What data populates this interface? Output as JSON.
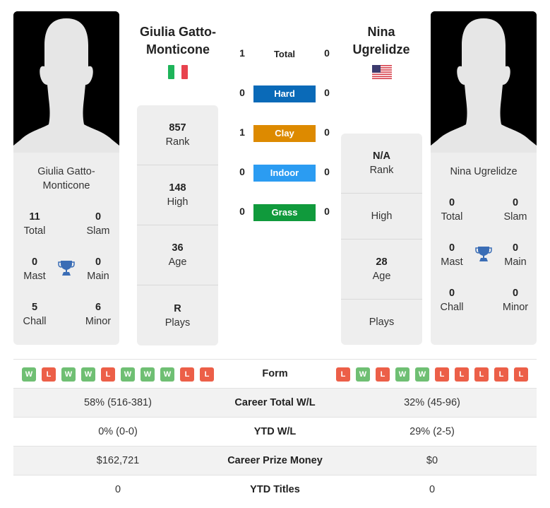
{
  "colors": {
    "hard": "#0a6ab8",
    "clay": "#dd8a00",
    "indoor": "#2b9cf2",
    "grass": "#109a3c",
    "win": "#6fbf73",
    "loss": "#ec5f48",
    "trophy": "#3a6db5"
  },
  "player1": {
    "name": "Giulia Gatto-Monticone",
    "card_name": "Giulia Gatto-Monticone",
    "flag": "italy-flag",
    "stats": {
      "rank": {
        "value": "857",
        "label": "Rank"
      },
      "high": {
        "value": "148",
        "label": "High"
      },
      "age": {
        "value": "36",
        "label": "Age"
      },
      "plays": {
        "value": "R",
        "label": "Plays"
      }
    },
    "titles": {
      "total": {
        "value": "11",
        "label": "Total"
      },
      "slam": {
        "value": "0",
        "label": "Slam"
      },
      "mast": {
        "value": "0",
        "label": "Mast"
      },
      "main": {
        "value": "0",
        "label": "Main"
      },
      "chall": {
        "value": "5",
        "label": "Chall"
      },
      "minor": {
        "value": "6",
        "label": "Minor"
      }
    },
    "form": [
      "W",
      "L",
      "W",
      "W",
      "L",
      "W",
      "W",
      "W",
      "L",
      "L"
    ]
  },
  "player2": {
    "name": "Nina Ugrelidze",
    "card_name": "Nina Ugrelidze",
    "flag": "usa-flag",
    "stats": {
      "rank": {
        "value": "N/A",
        "label": "Rank"
      },
      "high": {
        "value": "",
        "label": "High"
      },
      "age": {
        "value": "28",
        "label": "Age"
      },
      "plays": {
        "value": "",
        "label": "Plays"
      }
    },
    "titles": {
      "total": {
        "value": "0",
        "label": "Total"
      },
      "slam": {
        "value": "0",
        "label": "Slam"
      },
      "mast": {
        "value": "0",
        "label": "Mast"
      },
      "main": {
        "value": "0",
        "label": "Main"
      },
      "chall": {
        "value": "0",
        "label": "Chall"
      },
      "minor": {
        "value": "0",
        "label": "Minor"
      }
    },
    "form": [
      "L",
      "W",
      "L",
      "W",
      "W",
      "L",
      "L",
      "L",
      "L",
      "L"
    ]
  },
  "h2h": [
    {
      "label": "Total",
      "p1": "1",
      "p2": "0",
      "surface": "total"
    },
    {
      "label": "Hard",
      "p1": "0",
      "p2": "0",
      "surface": "hard"
    },
    {
      "label": "Clay",
      "p1": "1",
      "p2": "0",
      "surface": "clay"
    },
    {
      "label": "Indoor",
      "p1": "0",
      "p2": "0",
      "surface": "indoor"
    },
    {
      "label": "Grass",
      "p1": "0",
      "p2": "0",
      "surface": "grass"
    }
  ],
  "comparison": {
    "form_label": "Form",
    "rows": [
      {
        "label": "Career Total W/L",
        "p1": "58% (516-381)",
        "p2": "32% (45-96)"
      },
      {
        "label": "YTD W/L",
        "p1": "0% (0-0)",
        "p2": "29% (2-5)"
      },
      {
        "label": "Career Prize Money",
        "p1": "$162,721",
        "p2": "$0"
      },
      {
        "label": "YTD Titles",
        "p1": "0",
        "p2": "0"
      }
    ]
  }
}
